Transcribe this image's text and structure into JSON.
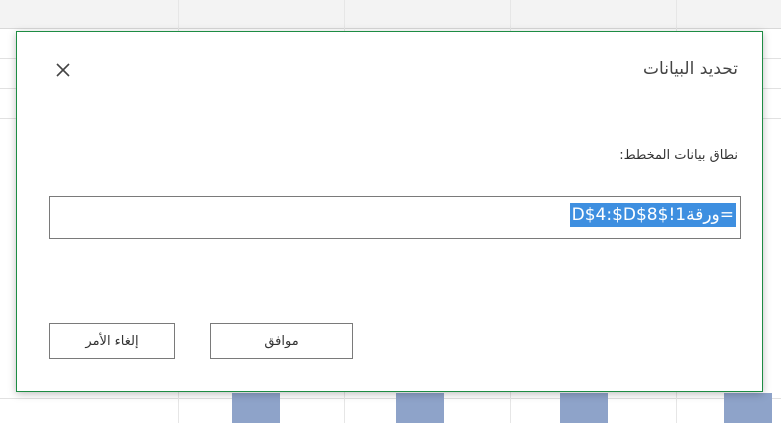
{
  "dialog": {
    "title": "تحديد البيانات",
    "close_icon": "close-icon",
    "range_label": "نطاق بيانات المخطط:",
    "range_value": "=ورقة1!$D$4:$D$8",
    "ok_label": "موافق",
    "cancel_label": "إلغاء الأمر"
  },
  "colors": {
    "dialog_border": "#1d8c43",
    "selection": "#3e8fe0",
    "chart_bar": "#8ea3c9"
  }
}
